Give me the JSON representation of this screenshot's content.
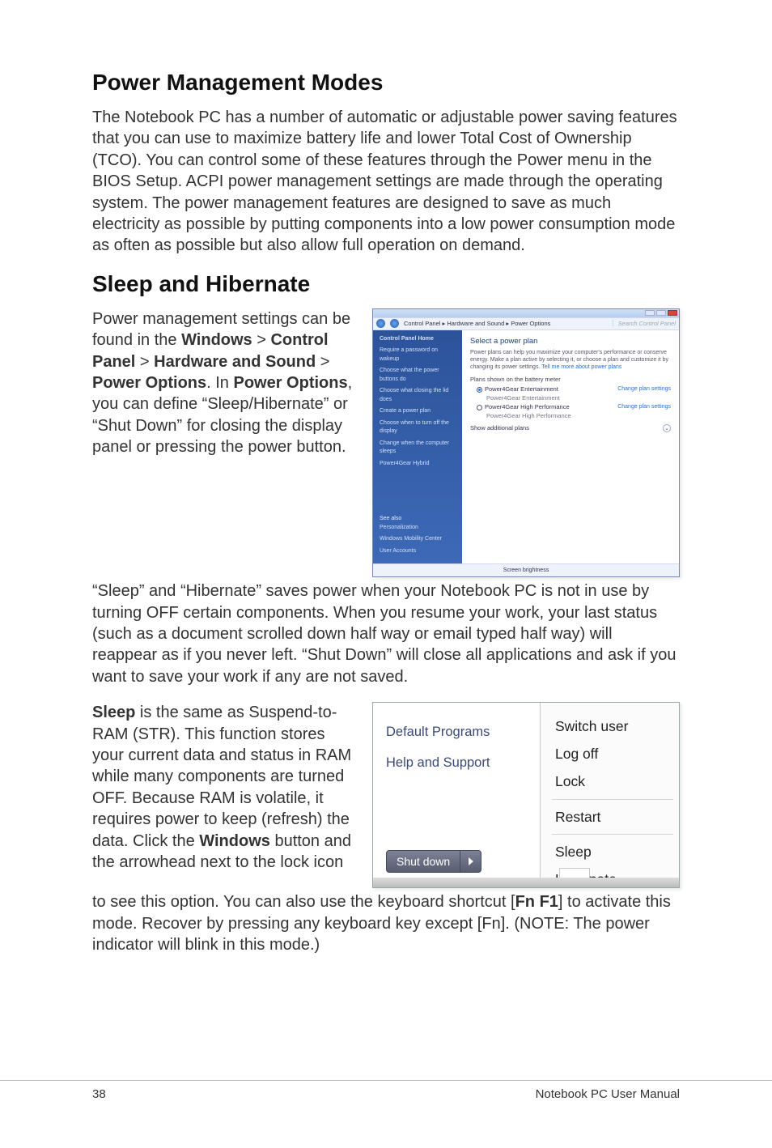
{
  "headings": {
    "h1": "Power Management Modes",
    "h2": "Sleep and Hibernate"
  },
  "paragraphs": {
    "p1": "The Notebook PC has a number of automatic or adjustable power saving features that you can use to maximize battery life and lower Total Cost of Ownership (TCO). You can control some of these features through the Power menu in the BIOS Setup. ACPI power management settings are made through the operating system. The power management features are designed to save as much electricity as possible by putting components into a low power consumption mode as often as possible but also allow full operation on demand.",
    "p2_a": "Power management settings can be found in the ",
    "p2_b": "Windows",
    "p2_c": " > ",
    "p2_d": "Control Panel",
    "p2_e": " > ",
    "p2_f": "Hardware and Sound",
    "p2_g": " > ",
    "p2_h": "Power Options",
    "p2_i": ". In ",
    "p2_j": "Power Options",
    "p2_k": ", you can define “Sleep/Hibernate” or “Shut Down” for closing the display panel or pressing the power button.",
    "p3": "“Sleep” and “Hibernate” saves power when your Notebook PC is not in use by turning OFF certain components. When you resume your work, your last status (such as a document scrolled down half way or email typed half way) will reappear as if you never left. “Shut Down” will close all applications and ask if you want to save your work if any are not saved.",
    "p4_a": "Sleep",
    "p4_b": " is the same as Suspend-to-RAM (STR). This function stores your current data and status in RAM while many components are turned OFF. Because RAM is volatile, it requires power to keep (refresh) the data. Click the ",
    "p4_c": "Windows",
    "p4_d": " button and the arrowhead next to the lock icon",
    "p5_a": "to see this option. You can also use the keyboard shortcut [",
    "p5_b": "Fn F1",
    "p5_c": "] to activate this mode. Recover by pressing any keyboard key except [Fn]. (NOTE: The power indicator will blink in this mode.)"
  },
  "control_panel": {
    "breadcrumb": "Control Panel  ▸  Hardware and Sound  ▸  Power Options",
    "search_placeholder": "Search Control Panel",
    "sidebar": {
      "home": "Control Panel Home",
      "links": [
        "Require a password on wakeup",
        "Choose what the power buttons do",
        "Choose what closing the lid does",
        "Create a power plan",
        "Choose when to turn off the display",
        "Change when the computer sleeps",
        "Power4Gear Hybrid"
      ],
      "see_also_label": "See also",
      "see_also": [
        "Personalization",
        "Windows Mobility Center",
        "User Accounts"
      ]
    },
    "main": {
      "title": "Select a power plan",
      "desc_a": "Power plans can help you maximize your computer's performance or conserve energy. Make a plan active by selecting it, or choose a plan and customize it by changing its power settings. ",
      "desc_link": "Tell me more about power plans",
      "meter_label": "Plans shown on the battery meter",
      "plans": [
        {
          "name": "Power4Gear Entertainment",
          "sub": "Power4Gear Entertainment",
          "selected": true,
          "change": "Change plan settings"
        },
        {
          "name": "Power4Gear High Performance",
          "sub": "Power4Gear High Performance",
          "selected": false,
          "change": "Change plan settings"
        }
      ],
      "show_additional": "Show additional plans"
    },
    "bottom_status": "Screen brightness"
  },
  "start_menu": {
    "left_items": [
      "Default Programs",
      "Help and Support"
    ],
    "shutdown_label": "Shut down",
    "right_items": [
      "Switch user",
      "Log off",
      "Lock",
      "Restart",
      "Sleep",
      "Hibernate"
    ]
  },
  "footer": {
    "page": "38",
    "title": "Notebook PC User Manual"
  }
}
